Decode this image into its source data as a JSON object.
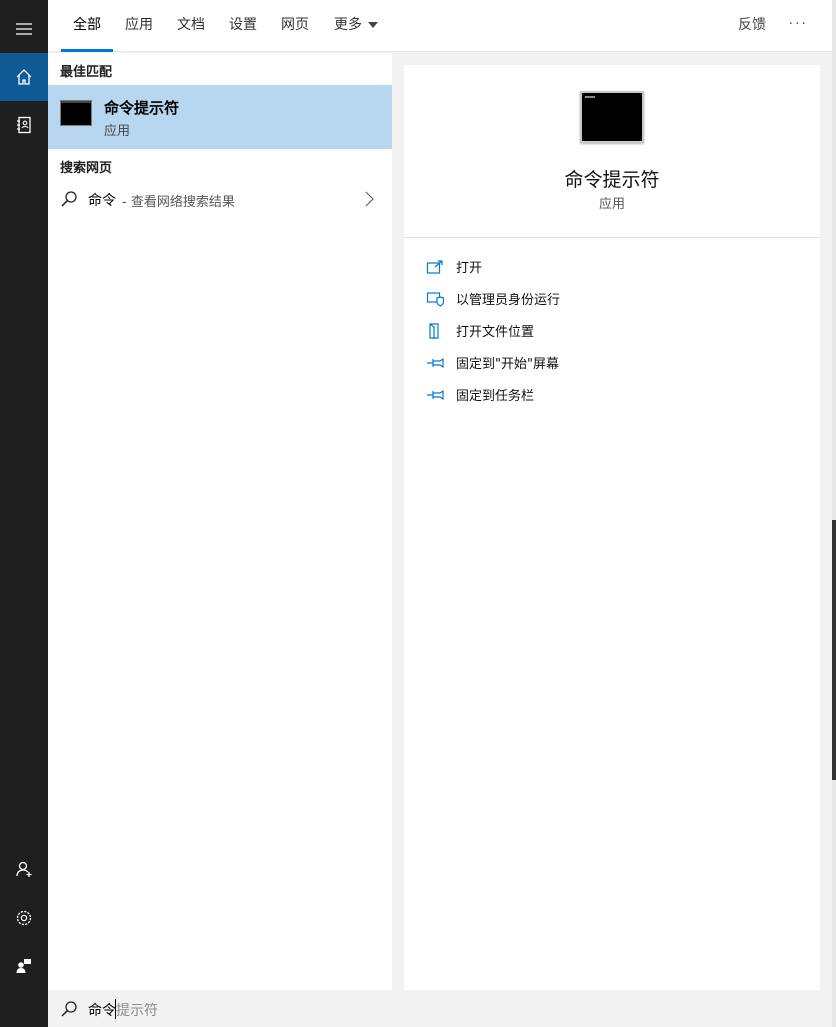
{
  "colors": {
    "rail": "#1f1f1f",
    "accent": "#0078d7",
    "selected_bg": "#b7d7f0",
    "active_rail": "#0f5a94"
  },
  "rail": {
    "items": [
      {
        "icon": "hamburger-menu-icon"
      },
      {
        "icon": "home-icon",
        "active": true
      },
      {
        "icon": "notebook-icon"
      },
      {
        "icon": "add-user-icon"
      },
      {
        "icon": "gear-icon"
      },
      {
        "icon": "feedback-person-icon"
      }
    ]
  },
  "tabs": [
    {
      "label": "全部",
      "active": true
    },
    {
      "label": "应用"
    },
    {
      "label": "文档"
    },
    {
      "label": "设置"
    },
    {
      "label": "网页"
    },
    {
      "label": "更多"
    }
  ],
  "header": {
    "feedback_label": "反馈",
    "more_label": "···"
  },
  "results": {
    "best_match_heading": "最佳匹配",
    "best_match": {
      "title": "命令提示符",
      "subtitle": "应用",
      "icon": "command-prompt-icon"
    },
    "web_heading": "搜索网页",
    "web_item": {
      "query": "命令",
      "hint": "- 查看网络搜索结果"
    }
  },
  "preview": {
    "title": "命令提示符",
    "subtitle": "应用",
    "actions": [
      {
        "label": "打开",
        "icon": "open-icon"
      },
      {
        "label": "以管理员身份运行",
        "icon": "shield-icon"
      },
      {
        "label": "打开文件位置",
        "icon": "file-location-icon"
      },
      {
        "label": "固定到\"开始\"屏幕",
        "icon": "pin-icon"
      },
      {
        "label": "固定到任务栏",
        "icon": "pin-icon"
      }
    ]
  },
  "search": {
    "typed": "命令",
    "suggestion": "提示符"
  }
}
